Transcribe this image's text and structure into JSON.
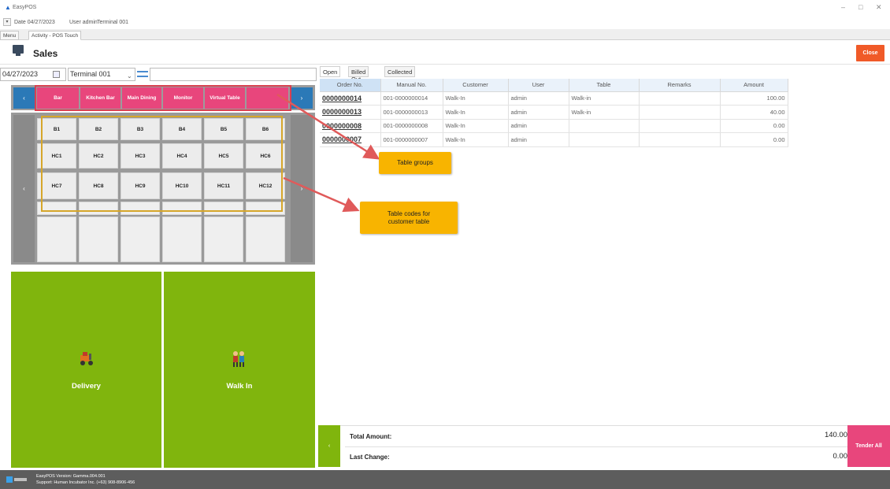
{
  "window": {
    "title": "EasyPOS",
    "controls": [
      "–",
      "□",
      "✕"
    ]
  },
  "infobar": {
    "dropdown_glyph": "▾",
    "date": "Date 04/27/2023",
    "user": "User admin",
    "terminal": "Terminal 001"
  },
  "tabs": [
    {
      "label": "Menu"
    },
    {
      "label": "Activity - POS Touch"
    }
  ],
  "page": {
    "title": "Sales",
    "close_label": "Close"
  },
  "filters": {
    "date_value": "04/27/2023",
    "terminal_value": "Terminal 001",
    "search_value": ""
  },
  "table_groups": {
    "prev_glyph": "‹",
    "next_glyph": "›",
    "items": [
      "Bar",
      "Kitchen Bar",
      "Main Dining",
      "Monitor",
      "Virtual Table",
      ""
    ]
  },
  "table_codes": {
    "rows": [
      [
        "B1",
        "B2",
        "B3",
        "B4",
        "B5",
        "B6"
      ],
      [
        "HC1",
        "HC2",
        "HC3",
        "HC4",
        "HC5",
        "HC6"
      ],
      [
        "HC7",
        "HC8",
        "HC9",
        "HC10",
        "HC11",
        "HC12"
      ],
      [
        "",
        "",
        "",
        "",
        "",
        ""
      ],
      [
        "",
        "",
        "",
        "",
        "",
        ""
      ]
    ],
    "prev_glyph": "‹",
    "next_glyph": "›"
  },
  "big_buttons": {
    "delivery_label": "Delivery",
    "walkin_label": "Walk In"
  },
  "callouts": {
    "table_groups": "Table groups",
    "table_codes": "Table codes for customer table"
  },
  "right_tabs": [
    "Open",
    "Billed Out",
    "Collected"
  ],
  "orders": {
    "columns": [
      "Order No.",
      "Manual No.",
      "Customer",
      "User",
      "Table",
      "Remarks",
      "Amount"
    ],
    "rows": [
      [
        "0000000014",
        "001-0000000014",
        "Walk-In",
        "admin",
        "Walk-in",
        "",
        "100.00"
      ],
      [
        "0000000013",
        "001-0000000013",
        "Walk-In",
        "admin",
        "Walk-in",
        "",
        "40.00"
      ],
      [
        "0000000008",
        "001-0000000008",
        "Walk-In",
        "admin",
        "",
        "",
        "0.00"
      ],
      [
        "0000000007",
        "001-0000000007",
        "Walk-In",
        "admin",
        "",
        "",
        "0.00"
      ]
    ]
  },
  "totals": {
    "nav_glyph": "‹",
    "total_label": "Total Amount:",
    "total_value": "140.00",
    "change_label": "Last Change:",
    "change_value": "0.00",
    "tender_label": "Tender All"
  },
  "footer": {
    "version": "EasyPOS Version: Gamma.004.001",
    "support": "Support: Human Incubator Inc. (+63) 908-8906-456"
  },
  "colors": {
    "group_pink": "#e8467c",
    "green": "#80b50d",
    "close_orange": "#f05a28",
    "callout_yellow": "#f8b400",
    "nav_blue": "#2b79b7"
  }
}
